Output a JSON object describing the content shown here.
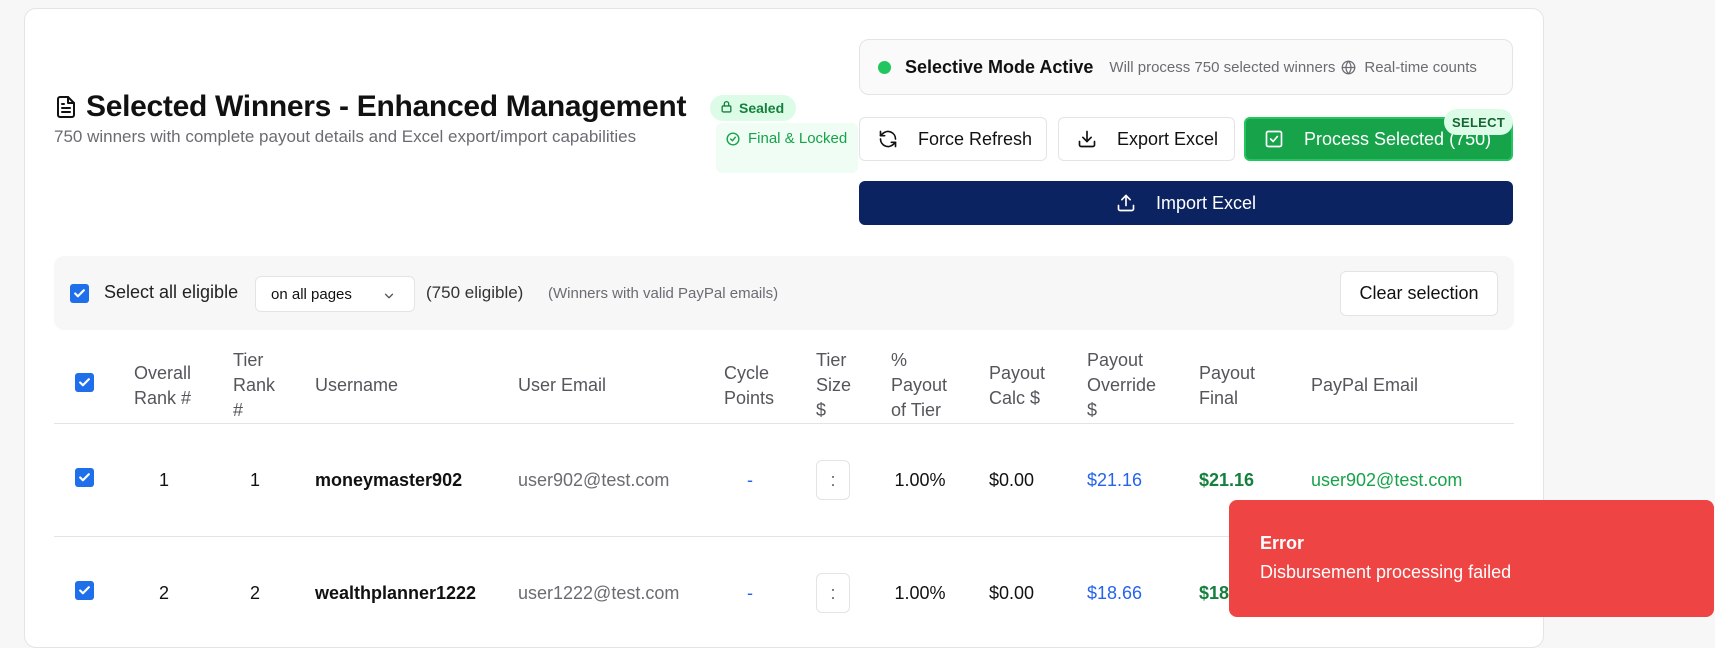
{
  "header": {
    "title": "Selected Winners - Enhanced Management",
    "subtitle": "750 winners with complete payout details and Excel export/import capabilities",
    "badge_sealed": "Sealed",
    "badge_final": "Final & Locked"
  },
  "mode": {
    "title": "Selective Mode Active",
    "description": "Will process 750 selected winners",
    "realtime": "Real-time counts",
    "indicator_color": "#22c55e"
  },
  "actions": {
    "refresh_label": "Force Refresh",
    "export_label": "Export Excel",
    "process_label": "Process Selected (750)",
    "select_tag": "SELECT",
    "import_label": "Import Excel"
  },
  "selection": {
    "select_all_label": "Select all eligible",
    "scope_value": "on all pages",
    "eligible_count": "(750 eligible)",
    "note": "(Winners with valid PayPal emails)",
    "clear_label": "Clear selection"
  },
  "table": {
    "headers": {
      "overall_rank": "Overall Rank #",
      "tier_rank": "Tier Rank #",
      "username": "Username",
      "user_email": "User Email",
      "cycle_points": "Cycle Points",
      "tier_size": "Tier Size $",
      "pct_payout": "% Payout of Tier",
      "payout_calc": "Payout Calc $",
      "payout_override": "Payout Override $",
      "payout_final": "Payout Final",
      "paypal_email": "PayPal Email"
    },
    "rows": [
      {
        "overall_rank": "1",
        "tier_rank": "1",
        "username": "moneymaster902",
        "user_email": "user902@test.com",
        "cycle_points": "-",
        "tier_size": ":",
        "pct_payout": "1.00%",
        "payout_calc": "$0.00",
        "payout_override": "$21.16",
        "payout_final": "$21.16",
        "paypal_email": "user902@test.com"
      },
      {
        "overall_rank": "2",
        "tier_rank": "2",
        "username": "wealthplanner1222",
        "user_email": "user1222@test.com",
        "cycle_points": "-",
        "tier_size": ":",
        "pct_payout": "1.00%",
        "payout_calc": "$0.00",
        "payout_override": "$18.66",
        "payout_final": "$18",
        "paypal_email": ""
      }
    ]
  },
  "toast": {
    "title": "Error",
    "message": "Disbursement processing failed",
    "color": "#ef4444"
  }
}
